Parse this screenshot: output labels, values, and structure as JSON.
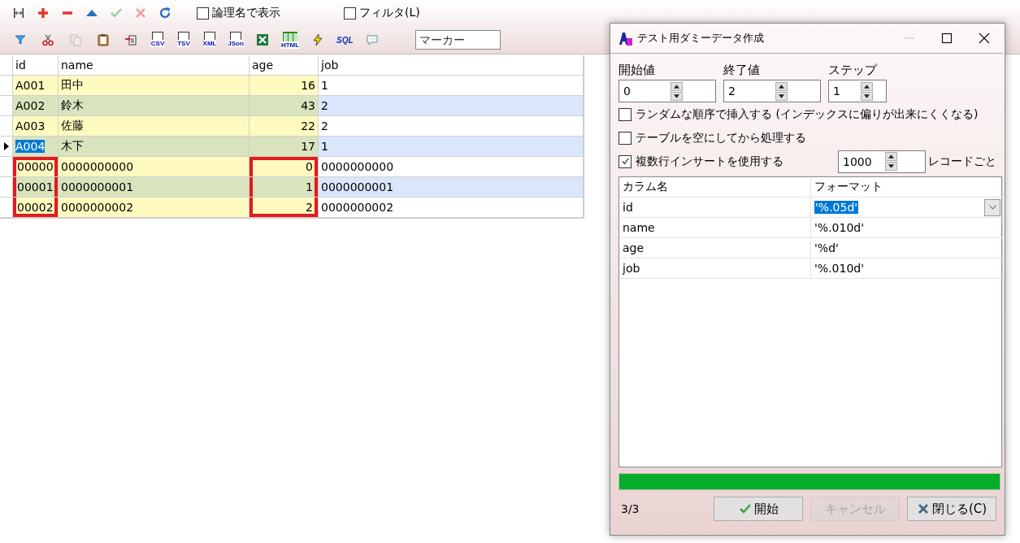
{
  "toolbar": {
    "tools": [
      {
        "kind": "fit",
        "disabled": false
      },
      {
        "kind": "add",
        "disabled": false
      },
      {
        "kind": "remove",
        "disabled": false
      },
      {
        "kind": "up",
        "disabled": false
      },
      {
        "kind": "apply",
        "disabled": true
      },
      {
        "kind": "cancel",
        "disabled": true
      },
      {
        "kind": "refresh",
        "disabled": false
      }
    ],
    "options": [
      {
        "label": "論理名で表示",
        "checked": false
      },
      {
        "label": "フィルタ(L)",
        "checked": false
      }
    ],
    "tools2": [
      {
        "kind": "filter",
        "disabled": false
      },
      {
        "kind": "cut",
        "disabled": false
      },
      {
        "kind": "copy",
        "disabled": true
      },
      {
        "kind": "paste",
        "disabled": false
      },
      {
        "kind": "import",
        "disabled": false
      },
      {
        "kind": "export",
        "label": "CSV",
        "disabled": false
      },
      {
        "kind": "export",
        "label": "TSV",
        "disabled": false
      },
      {
        "kind": "export",
        "label": "XML",
        "disabled": false
      },
      {
        "kind": "export",
        "label": "JSon",
        "disabled": false
      },
      {
        "kind": "excel",
        "disabled": false
      },
      {
        "kind": "html",
        "label": "HTML",
        "disabled": false
      },
      {
        "kind": "bolt",
        "disabled": false
      },
      {
        "kind": "sql",
        "label": "SQL",
        "disabled": false
      },
      {
        "kind": "comment",
        "disabled": false
      }
    ],
    "marker": {
      "placeholder": "マーカー"
    }
  },
  "table": {
    "columns": [
      {
        "label": "id",
        "kind": "text"
      },
      {
        "label": "name",
        "kind": "text"
      },
      {
        "label": "age",
        "kind": "number"
      },
      {
        "label": "job",
        "kind": "text"
      }
    ],
    "rows": [
      {
        "cells": [
          {
            "text": "A001",
            "outlined": false
          },
          {
            "text": "田中",
            "outlined": false
          },
          {
            "text": "16",
            "outlined": false
          },
          {
            "text": "1",
            "outlined": false
          }
        ],
        "selected": false
      },
      {
        "cells": [
          {
            "text": "A002",
            "outlined": false
          },
          {
            "text": "鈴木",
            "outlined": false
          },
          {
            "text": "43",
            "outlined": false
          },
          {
            "text": "2",
            "outlined": false
          }
        ],
        "selected": false
      },
      {
        "cells": [
          {
            "text": "A003",
            "outlined": false
          },
          {
            "text": "佐藤",
            "outlined": false
          },
          {
            "text": "22",
            "outlined": false
          },
          {
            "text": "2",
            "outlined": false
          }
        ],
        "selected": false
      },
      {
        "cells": [
          {
            "text": "A004",
            "outlined": false
          },
          {
            "text": "木下",
            "outlined": false
          },
          {
            "text": "17",
            "outlined": false
          },
          {
            "text": "1",
            "outlined": false
          }
        ],
        "selected": true
      },
      {
        "cells": [
          {
            "text": "00000",
            "outlined": true
          },
          {
            "text": "0000000000",
            "outlined": false
          },
          {
            "text": "0",
            "outlined": true
          },
          {
            "text": "0000000000",
            "outlined": false
          }
        ],
        "selected": false
      },
      {
        "cells": [
          {
            "text": "00001",
            "outlined": true
          },
          {
            "text": "0000000001",
            "outlined": false
          },
          {
            "text": "1",
            "outlined": true
          },
          {
            "text": "0000000001",
            "outlined": false
          }
        ],
        "selected": false
      },
      {
        "cells": [
          {
            "text": "00002",
            "outlined": true
          },
          {
            "text": "0000000002",
            "outlined": false
          },
          {
            "text": "2",
            "outlined": true
          },
          {
            "text": "0000000002",
            "outlined": false
          }
        ],
        "selected": false
      }
    ]
  },
  "dialog": {
    "title": "テスト用ダミーデータ作成",
    "spins": [
      {
        "label": "開始値",
        "value": "0"
      },
      {
        "label": "終了値",
        "value": "2"
      },
      {
        "label": "ステップ",
        "value": "1"
      }
    ],
    "options": [
      {
        "label": "ランダムな順序で挿入する (インデックスに偏りが出来にくくなる)",
        "checked": false
      },
      {
        "label": "テーブルを空にしてから処理する",
        "checked": false
      },
      {
        "label": "複数行インサートを使用する",
        "checked": true
      }
    ],
    "batch": {
      "value": "1000",
      "unit": "レコードごと"
    },
    "grid": {
      "columns": [
        "カラム名",
        "フォーマット"
      ],
      "rows": [
        {
          "name": "id",
          "format": "'%.05d'",
          "selected": true
        },
        {
          "name": "name",
          "format": "'%.010d'",
          "selected": false
        },
        {
          "name": "age",
          "format": "'%d'",
          "selected": false
        },
        {
          "name": "job",
          "format": "'%.010d'",
          "selected": false
        }
      ]
    },
    "progress": {
      "level": 1
    },
    "status": "3/3",
    "buttons": [
      {
        "kind": "start",
        "label": "開始",
        "disabled": false
      },
      {
        "kind": "cancel",
        "label": "キャンセル",
        "disabled": true
      },
      {
        "kind": "close",
        "label": "閉じる(C)",
        "disabled": false
      }
    ]
  }
}
